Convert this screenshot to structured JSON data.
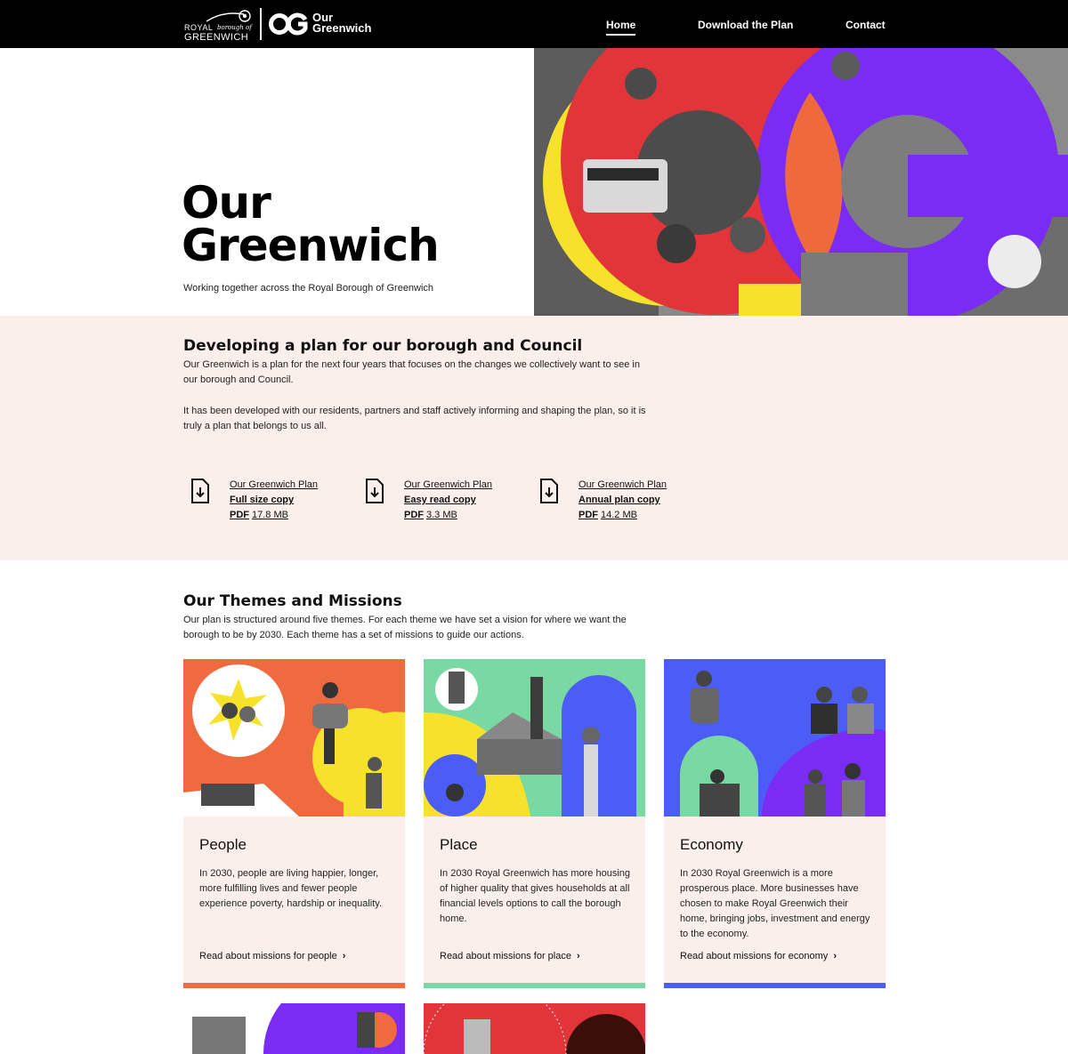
{
  "header": {
    "logo_royal": "ROYAL",
    "logo_borough_of": "borough of",
    "logo_greenwich": "GREENWICH",
    "logo_our": "Our",
    "logo_greenwich_brand": "Greenwich",
    "nav": {
      "home": "Home",
      "download": "Download the Plan",
      "contact": "Contact"
    }
  },
  "hero": {
    "title_line1": "Our",
    "title_line2": "Greenwich",
    "subtitle": "Working together across the Royal Borough of Greenwich"
  },
  "plan": {
    "heading": "Developing a plan for our borough and Council",
    "paragraph1": "Our Greenwich is a plan for the next four years that focuses on the changes we collectively want to see in our borough and Council.",
    "paragraph2": "It has been developed with our residents, partners and staff actively informing and shaping the plan, so it is truly a plan that belongs to us all.",
    "downloads": [
      {
        "title": "Our Greenwich Plan",
        "variant": "Full size copy",
        "format": "PDF",
        "size": "17.8 MB"
      },
      {
        "title": "Our Greenwich Plan",
        "variant": "Easy read copy",
        "format": "PDF",
        "size": "3.3 MB"
      },
      {
        "title": "Our Greenwich Plan",
        "variant": "Annual plan copy",
        "format": "PDF",
        "size": "14.2 MB"
      }
    ]
  },
  "themes": {
    "heading": "Our Themes and Missions",
    "paragraph": "Our plan is structured around five themes. For each theme we have set a vision for where we want the borough to be by 2030. Each theme has a set of missions to guide our actions.",
    "cards": [
      {
        "title": "People",
        "description": "In 2030, people are living happier, longer, more fulfilling lives and fewer people experience poverty, hardship or inequality.",
        "link": "Read about missions for people",
        "accent": "#ef6b3f"
      },
      {
        "title": "Place",
        "description": "In 2030 Royal Greenwich has more housing of higher quality that gives households at all financial levels options to call the borough home.",
        "link": "Read about missions for place",
        "accent": "#7ad9a3"
      },
      {
        "title": "Economy",
        "description": "In 2030 Royal Greenwich is a more prosperous place. More businesses have chosen to make Royal Greenwich their home, bringing jobs, investment and energy to the economy.",
        "link": "Read about missions for economy",
        "accent": "#4b5cf7"
      }
    ]
  },
  "colors": {
    "header_bg": "#000000",
    "section_tint": "#fbefeb",
    "hero_red": "#e2353a",
    "hero_purple": "#7a2cf5",
    "hero_yellow": "#f7e22b",
    "hero_orange": "#ee6a3d"
  },
  "icons": [
    "crown-logo-icon",
    "og-logo-icon",
    "file-download-icon",
    "chevron-right-icon"
  ]
}
